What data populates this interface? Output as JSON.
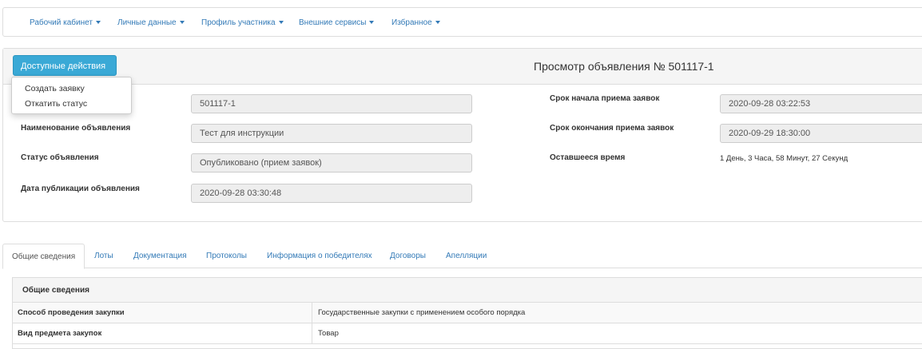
{
  "nav": {
    "items": [
      {
        "label": "Рабочий кабинет"
      },
      {
        "label": "Личные данные"
      },
      {
        "label": "Профиль участника"
      },
      {
        "label": "Внешние сервисы"
      },
      {
        "label": "Избранное"
      }
    ]
  },
  "header": {
    "actions_label": "Доступные действия",
    "title": "Просмотр объявления № 501117-1"
  },
  "actions_menu": {
    "items": [
      {
        "label": "Создать заявку"
      },
      {
        "label": "Откатить статус"
      }
    ]
  },
  "form": {
    "left": [
      {
        "label": "",
        "value": "501117-1"
      },
      {
        "label": "Наименование объявления",
        "value": "Тест для инструкции"
      },
      {
        "label": "Статус объявления",
        "value": "Опубликовано (прием заявок)"
      },
      {
        "label": "Дата публикации объявления",
        "value": "2020-09-28 03:30:48"
      }
    ],
    "right": [
      {
        "label": "Срок начала приема заявок",
        "value": "2020-09-28 03:22:53"
      },
      {
        "label": "Срок окончания приема заявок",
        "value": "2020-09-29 18:30:00"
      },
      {
        "label": "Оставшееся время",
        "value": "1 День, 3 Часа, 58 Минут, 27 Секунд"
      }
    ]
  },
  "tabs": [
    {
      "label": "Общие сведения",
      "active": true
    },
    {
      "label": "Лоты"
    },
    {
      "label": "Документация"
    },
    {
      "label": "Протоколы"
    },
    {
      "label": "Информация о победителях"
    },
    {
      "label": "Договоры"
    },
    {
      "label": "Апелляции"
    }
  ],
  "general": {
    "title": "Общие сведения",
    "rows": [
      {
        "label": "Способ проведения закупки",
        "value": "Государственные закупки с применением особого порядка"
      },
      {
        "label": "Вид предмета закупок",
        "value": "Товар"
      }
    ]
  },
  "colors": {
    "link": "#337ab7",
    "primary_button": "#3aa9d6",
    "panel_bg": "#f5f5f5",
    "border": "#dddddd",
    "readonly_bg": "#eeeeee"
  }
}
